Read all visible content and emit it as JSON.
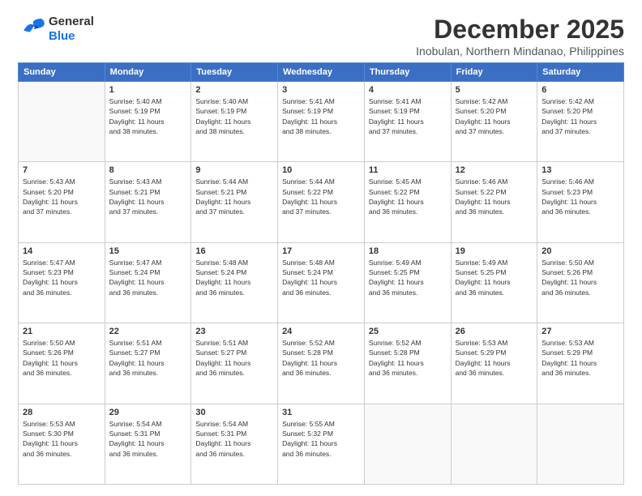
{
  "header": {
    "logo_general": "General",
    "logo_blue": "Blue",
    "month": "December 2025",
    "location": "Inobulan, Northern Mindanao, Philippines"
  },
  "days_of_week": [
    "Sunday",
    "Monday",
    "Tuesday",
    "Wednesday",
    "Thursday",
    "Friday",
    "Saturday"
  ],
  "weeks": [
    [
      {
        "day": "",
        "info": ""
      },
      {
        "day": "1",
        "info": "Sunrise: 5:40 AM\nSunset: 5:19 PM\nDaylight: 11 hours\nand 38 minutes."
      },
      {
        "day": "2",
        "info": "Sunrise: 5:40 AM\nSunset: 5:19 PM\nDaylight: 11 hours\nand 38 minutes."
      },
      {
        "day": "3",
        "info": "Sunrise: 5:41 AM\nSunset: 5:19 PM\nDaylight: 11 hours\nand 38 minutes."
      },
      {
        "day": "4",
        "info": "Sunrise: 5:41 AM\nSunset: 5:19 PM\nDaylight: 11 hours\nand 37 minutes."
      },
      {
        "day": "5",
        "info": "Sunrise: 5:42 AM\nSunset: 5:20 PM\nDaylight: 11 hours\nand 37 minutes."
      },
      {
        "day": "6",
        "info": "Sunrise: 5:42 AM\nSunset: 5:20 PM\nDaylight: 11 hours\nand 37 minutes."
      }
    ],
    [
      {
        "day": "7",
        "info": "Sunrise: 5:43 AM\nSunset: 5:20 PM\nDaylight: 11 hours\nand 37 minutes."
      },
      {
        "day": "8",
        "info": "Sunrise: 5:43 AM\nSunset: 5:21 PM\nDaylight: 11 hours\nand 37 minutes."
      },
      {
        "day": "9",
        "info": "Sunrise: 5:44 AM\nSunset: 5:21 PM\nDaylight: 11 hours\nand 37 minutes."
      },
      {
        "day": "10",
        "info": "Sunrise: 5:44 AM\nSunset: 5:22 PM\nDaylight: 11 hours\nand 37 minutes."
      },
      {
        "day": "11",
        "info": "Sunrise: 5:45 AM\nSunset: 5:22 PM\nDaylight: 11 hours\nand 36 minutes."
      },
      {
        "day": "12",
        "info": "Sunrise: 5:46 AM\nSunset: 5:22 PM\nDaylight: 11 hours\nand 36 minutes."
      },
      {
        "day": "13",
        "info": "Sunrise: 5:46 AM\nSunset: 5:23 PM\nDaylight: 11 hours\nand 36 minutes."
      }
    ],
    [
      {
        "day": "14",
        "info": "Sunrise: 5:47 AM\nSunset: 5:23 PM\nDaylight: 11 hours\nand 36 minutes."
      },
      {
        "day": "15",
        "info": "Sunrise: 5:47 AM\nSunset: 5:24 PM\nDaylight: 11 hours\nand 36 minutes."
      },
      {
        "day": "16",
        "info": "Sunrise: 5:48 AM\nSunset: 5:24 PM\nDaylight: 11 hours\nand 36 minutes."
      },
      {
        "day": "17",
        "info": "Sunrise: 5:48 AM\nSunset: 5:24 PM\nDaylight: 11 hours\nand 36 minutes."
      },
      {
        "day": "18",
        "info": "Sunrise: 5:49 AM\nSunset: 5:25 PM\nDaylight: 11 hours\nand 36 minutes."
      },
      {
        "day": "19",
        "info": "Sunrise: 5:49 AM\nSunset: 5:25 PM\nDaylight: 11 hours\nand 36 minutes."
      },
      {
        "day": "20",
        "info": "Sunrise: 5:50 AM\nSunset: 5:26 PM\nDaylight: 11 hours\nand 36 minutes."
      }
    ],
    [
      {
        "day": "21",
        "info": "Sunrise: 5:50 AM\nSunset: 5:26 PM\nDaylight: 11 hours\nand 36 minutes."
      },
      {
        "day": "22",
        "info": "Sunrise: 5:51 AM\nSunset: 5:27 PM\nDaylight: 11 hours\nand 36 minutes."
      },
      {
        "day": "23",
        "info": "Sunrise: 5:51 AM\nSunset: 5:27 PM\nDaylight: 11 hours\nand 36 minutes."
      },
      {
        "day": "24",
        "info": "Sunrise: 5:52 AM\nSunset: 5:28 PM\nDaylight: 11 hours\nand 36 minutes."
      },
      {
        "day": "25",
        "info": "Sunrise: 5:52 AM\nSunset: 5:28 PM\nDaylight: 11 hours\nand 36 minutes."
      },
      {
        "day": "26",
        "info": "Sunrise: 5:53 AM\nSunset: 5:29 PM\nDaylight: 11 hours\nand 36 minutes."
      },
      {
        "day": "27",
        "info": "Sunrise: 5:53 AM\nSunset: 5:29 PM\nDaylight: 11 hours\nand 36 minutes."
      }
    ],
    [
      {
        "day": "28",
        "info": "Sunrise: 5:53 AM\nSunset: 5:30 PM\nDaylight: 11 hours\nand 36 minutes."
      },
      {
        "day": "29",
        "info": "Sunrise: 5:54 AM\nSunset: 5:31 PM\nDaylight: 11 hours\nand 36 minutes."
      },
      {
        "day": "30",
        "info": "Sunrise: 5:54 AM\nSunset: 5:31 PM\nDaylight: 11 hours\nand 36 minutes."
      },
      {
        "day": "31",
        "info": "Sunrise: 5:55 AM\nSunset: 5:32 PM\nDaylight: 11 hours\nand 36 minutes."
      },
      {
        "day": "",
        "info": ""
      },
      {
        "day": "",
        "info": ""
      },
      {
        "day": "",
        "info": ""
      }
    ]
  ]
}
